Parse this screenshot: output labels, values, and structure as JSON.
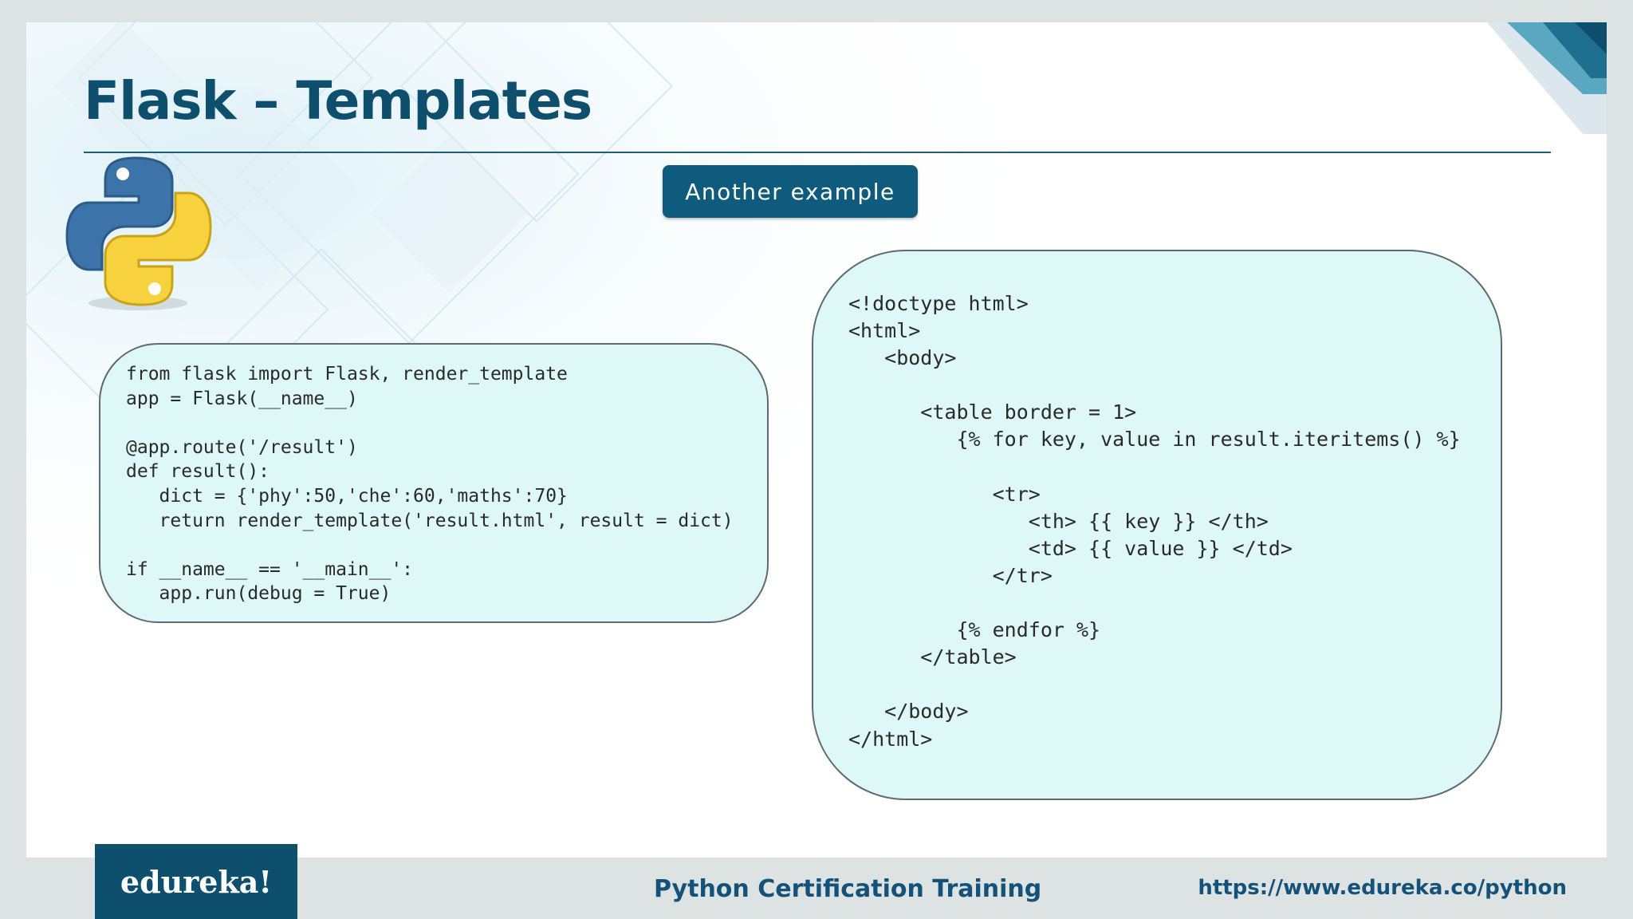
{
  "slide": {
    "title": "Flask – Templates",
    "badge": "Another example",
    "code_left": "from flask import Flask, render_template\napp = Flask(__name__)\n\n@app.route('/result')\ndef result():\n   dict = {'phy':50,'che':60,'maths':70}\n   return render_template('result.html', result = dict)\n\nif __name__ == '__main__':\n   app.run(debug = True)",
    "code_right": "<!doctype html>\n<html>\n   <body>\n\n      <table border = 1>\n         {% for key, value in result.iteritems() %}\n\n            <tr>\n               <th> {{ key }} </th>\n               <td> {{ value }} </td>\n            </tr>\n\n         {% endfor %}\n      </table>\n\n   </body>\n</html>"
  },
  "footer": {
    "logo": "edureka!",
    "center": "Python Certification Training",
    "url": "https://www.edureka.co/python"
  },
  "colors": {
    "title": "#0f4f6e",
    "badge_bg": "#0f5b7d",
    "code_bg": "#def7f7",
    "footer_text": "#15527a",
    "footer_bg": "#dde3e2"
  },
  "icons": {
    "python_logo": "python-logo-icon"
  }
}
